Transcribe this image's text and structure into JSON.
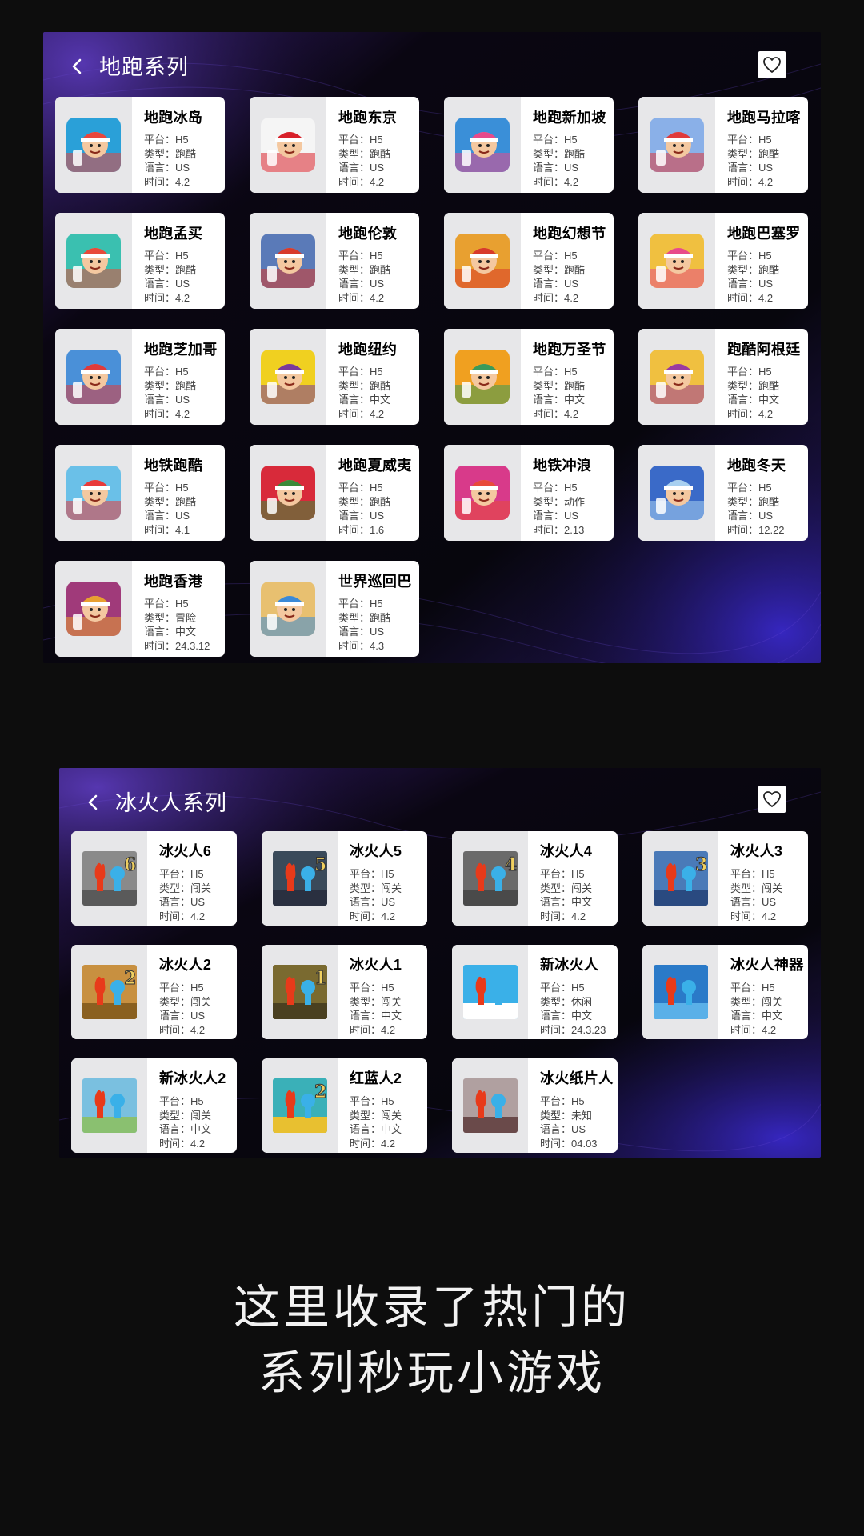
{
  "sections": [
    {
      "title": "地跑系列",
      "games": [
        {
          "name": "地跑冰岛",
          "platform": "平台：H5",
          "type": "类型：跑酷",
          "lang": "语言：US",
          "time": "时间：4.2",
          "colors": [
            "#2aa0d8",
            "#e8463c"
          ]
        },
        {
          "name": "地跑东京",
          "platform": "平台：H5",
          "type": "类型：跑酷",
          "lang": "语言：US",
          "time": "时间：4.2",
          "colors": [
            "#f5f5f5",
            "#d8202a"
          ]
        },
        {
          "name": "地跑新加坡",
          "platform": "平台：H5",
          "type": "类型：跑酷",
          "lang": "语言：US",
          "time": "时间：4.2",
          "colors": [
            "#3a8fd8",
            "#e84a8a"
          ]
        },
        {
          "name": "地跑马拉喀",
          "platform": "平台：H5",
          "type": "类型：跑酷",
          "lang": "语言：US",
          "time": "时间：4.2",
          "colors": [
            "#8ab0e8",
            "#e03a3a"
          ]
        },
        {
          "name": "地跑孟买",
          "platform": "平台：H5",
          "type": "类型：跑酷",
          "lang": "语言：US",
          "time": "时间：4.2",
          "colors": [
            "#3ac0b0",
            "#e84a3a"
          ]
        },
        {
          "name": "地跑伦敦",
          "platform": "平台：H5",
          "type": "类型：跑酷",
          "lang": "语言：US",
          "time": "时间：4.2",
          "colors": [
            "#5a7ab8",
            "#d83a2a"
          ]
        },
        {
          "name": "地跑幻想节",
          "platform": "平台：H5",
          "type": "类型：跑酷",
          "lang": "语言：US",
          "time": "时间：4.2",
          "colors": [
            "#e8a030",
            "#d83a2a"
          ]
        },
        {
          "name": "地跑巴塞罗",
          "platform": "平台：H5",
          "type": "类型：跑酷",
          "lang": "语言：US",
          "time": "时间：4.2",
          "colors": [
            "#f0c040",
            "#e84a8a"
          ]
        },
        {
          "name": "地跑芝加哥",
          "platform": "平台：H5",
          "type": "类型：跑酷",
          "lang": "语言：US",
          "time": "时间：4.2",
          "colors": [
            "#4a90d8",
            "#e03a3a"
          ]
        },
        {
          "name": "地跑纽约",
          "platform": "平台：H5",
          "type": "类型：跑酷",
          "lang": "语言：中文",
          "time": "时间：4.2",
          "colors": [
            "#f0d020",
            "#7a3a9a"
          ]
        },
        {
          "name": "地跑万圣节",
          "platform": "平台：H5",
          "type": "类型：跑酷",
          "lang": "语言：中文",
          "time": "时间：4.2",
          "colors": [
            "#f0a020",
            "#3a9a5a"
          ]
        },
        {
          "name": "跑酷阿根廷",
          "platform": "平台：H5",
          "type": "类型：跑酷",
          "lang": "语言：中文",
          "time": "时间：4.2",
          "colors": [
            "#f0c040",
            "#9a3aa0"
          ]
        },
        {
          "name": "地铁跑酷",
          "platform": "平台：H5",
          "type": "类型：跑酷",
          "lang": "语言：US",
          "time": "时间：4.1",
          "colors": [
            "#6ac0e8",
            "#e83a3a"
          ]
        },
        {
          "name": "地跑夏威夷",
          "platform": "平台：H5",
          "type": "类型：跑酷",
          "lang": "语言：US",
          "time": "时间：1.6",
          "colors": [
            "#d82a3a",
            "#3a8a3a"
          ]
        },
        {
          "name": "地铁冲浪",
          "platform": "平台：H5",
          "type": "类型：动作",
          "lang": "语言：US",
          "time": "时间：2.13",
          "colors": [
            "#d83a8a",
            "#e84a3a"
          ]
        },
        {
          "name": "地跑冬天",
          "platform": "平台：H5",
          "type": "类型：跑酷",
          "lang": "语言：US",
          "time": "时间：12.22",
          "colors": [
            "#3a6ac8",
            "#a8d0f0"
          ]
        },
        {
          "name": "地跑香港",
          "platform": "平台：H5",
          "type": "类型：冒险",
          "lang": "语言：中文",
          "time": "时间：24.3.12",
          "colors": [
            "#a03a7a",
            "#e8a030"
          ]
        },
        {
          "name": "世界巡回巴",
          "platform": "平台：H5",
          "type": "类型：跑酷",
          "lang": "语言：US",
          "time": "时间：4.3",
          "colors": [
            "#e8c070",
            "#3a8ad8"
          ]
        }
      ]
    },
    {
      "title": "冰火人系列",
      "games": [
        {
          "name": "冰火人6",
          "platform": "平台：H5",
          "type": "类型：闯关",
          "lang": "语言：US",
          "time": "时间：4.2",
          "num": "6",
          "colors": [
            "#8a8a8a",
            "#5a5a5a"
          ]
        },
        {
          "name": "冰火人5",
          "platform": "平台：H5",
          "type": "类型：闯关",
          "lang": "语言：US",
          "time": "时间：4.2",
          "num": "5",
          "colors": [
            "#3a4a5a",
            "#2a3040"
          ]
        },
        {
          "name": "冰火人4",
          "platform": "平台：H5",
          "type": "类型：闯关",
          "lang": "语言：中文",
          "time": "时间：4.2",
          "num": "4",
          "colors": [
            "#6a6a6a",
            "#4a4a4a"
          ]
        },
        {
          "name": "冰火人3",
          "platform": "平台：H5",
          "type": "类型：闯关",
          "lang": "语言：US",
          "time": "时间：4.2",
          "num": "3",
          "colors": [
            "#4a7ab8",
            "#2a4a80"
          ]
        },
        {
          "name": "冰火人2",
          "platform": "平台：H5",
          "type": "类型：闯关",
          "lang": "语言：US",
          "time": "时间：4.2",
          "num": "2",
          "colors": [
            "#c89040",
            "#8a6020"
          ]
        },
        {
          "name": "冰火人1",
          "platform": "平台：H5",
          "type": "类型：闯关",
          "lang": "语言：中文",
          "time": "时间：4.2",
          "num": "1",
          "colors": [
            "#7a6a30",
            "#4a4020"
          ]
        },
        {
          "name": "新冰火人",
          "platform": "平台：H5",
          "type": "类型：休闲",
          "lang": "语言：中文",
          "time": "时间：24.3.23",
          "num": "",
          "colors": [
            "#3ab0e8",
            "#ffffff"
          ]
        },
        {
          "name": "冰火人神器",
          "platform": "平台：H5",
          "type": "类型：闯关",
          "lang": "语言：中文",
          "time": "时间：4.2",
          "num": "",
          "colors": [
            "#2a7ac8",
            "#5ab0e8"
          ]
        },
        {
          "name": "新冰火人2",
          "platform": "平台：H5",
          "type": "类型：闯关",
          "lang": "语言：中文",
          "time": "时间：4.2",
          "num": "",
          "colors": [
            "#7ac0e0",
            "#8ac070"
          ]
        },
        {
          "name": "红蓝人2",
          "platform": "平台：H5",
          "type": "类型：闯关",
          "lang": "语言：中文",
          "time": "时间：4.2",
          "num": "2",
          "colors": [
            "#3ab0b8",
            "#e8c030"
          ]
        },
        {
          "name": "冰火纸片人",
          "platform": "平台：H5",
          "type": "类型：未知",
          "lang": "语言：US",
          "time": "时间：04.03",
          "num": "",
          "colors": [
            "#b0a0a0",
            "#6a4a4a"
          ]
        }
      ]
    }
  ],
  "slogan": {
    "line1": "这里收录了热门的",
    "line2": "系列秒玩小游戏"
  },
  "icons": {
    "back": "chevron-left-icon",
    "favorite": "heart-outline-icon"
  }
}
